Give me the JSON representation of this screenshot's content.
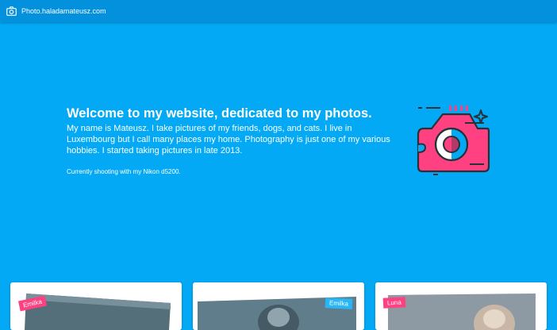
{
  "header": {
    "site_name": "Photo.haladamateusz.com",
    "icon": "camera-icon"
  },
  "hero": {
    "title": "Welcome to my website, dedicated to my photos.",
    "description": "My name is Mateusz. I take pictures of my friends, dogs, and cats. I live in Luxembourg but I call many places my home. Photography is just one of my various hobbies. I started taking pictures in late 2013.",
    "equipment_note": "Currently shooting with my Nikon d5200.",
    "illustration_icon": "camera-illustration-icon"
  },
  "gallery": {
    "cards": [
      {
        "tag": "Emilka",
        "tag_color": "#ff4081"
      },
      {
        "tag": "Emilka",
        "tag_color": "#29b6f6"
      },
      {
        "tag": "Luna",
        "tag_color": "#ff4081"
      }
    ]
  },
  "colors": {
    "background": "#03a9f4",
    "header": "#0390dd",
    "accent_pink": "#ff4081",
    "accent_blue": "#29b6f6"
  }
}
